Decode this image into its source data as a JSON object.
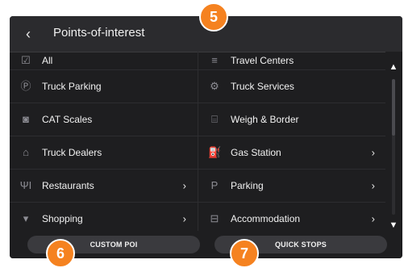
{
  "header": {
    "back_icon": "chevron-left",
    "title": "Points-of-interest"
  },
  "left_items": [
    {
      "label": "All",
      "icon": "checkbox-icon",
      "chevron": false
    },
    {
      "label": "Truck Parking",
      "icon": "parking-circle-icon",
      "chevron": false
    },
    {
      "label": "CAT Scales",
      "icon": "cat-scale-icon",
      "chevron": false
    },
    {
      "label": "Truck Dealers",
      "icon": "truck-dealer-icon",
      "chevron": false
    },
    {
      "label": "Restaurants",
      "icon": "fork-knife-icon",
      "chevron": true
    },
    {
      "label": "Shopping",
      "icon": "cart-icon",
      "chevron": true
    }
  ],
  "right_items": [
    {
      "label": "Travel Centers",
      "icon": "travel-center-icon",
      "chevron": false
    },
    {
      "label": "Truck Services",
      "icon": "truck-service-icon",
      "chevron": false
    },
    {
      "label": "Weigh & Border",
      "icon": "weigh-border-icon",
      "chevron": false
    },
    {
      "label": "Gas Station",
      "icon": "gas-pump-icon",
      "chevron": true
    },
    {
      "label": "Parking",
      "icon": "p-letter-icon",
      "chevron": true
    },
    {
      "label": "Accommodation",
      "icon": "bed-icon",
      "chevron": true
    }
  ],
  "icons": {
    "checkbox": "☑",
    "parking_circle": "Ⓟ",
    "cat_scale": "◙",
    "truck_dealer": "⌂",
    "fork_knife": "ΨΙ",
    "cart": "▾",
    "travel_center": "≡",
    "truck_service": "⚙",
    "weigh_border": "⌸",
    "gas_pump": "⛽",
    "p_letter": "P",
    "bed": "⊟",
    "chevron_right": "›",
    "chevron_left": "‹",
    "scroll_up": "▲",
    "scroll_down": "▼"
  },
  "buttons": {
    "custom_poi": "CUSTOM POI",
    "quick_stops": "QUICK STOPS"
  },
  "callouts": {
    "five": "5",
    "six": "6",
    "seven": "7"
  },
  "colors": {
    "background": "#1e1e20",
    "header": "#2b2b2e",
    "button": "#3a3a3e",
    "text": "#f2f2f2",
    "icon": "#8e8e95",
    "callout": "#f58220"
  }
}
